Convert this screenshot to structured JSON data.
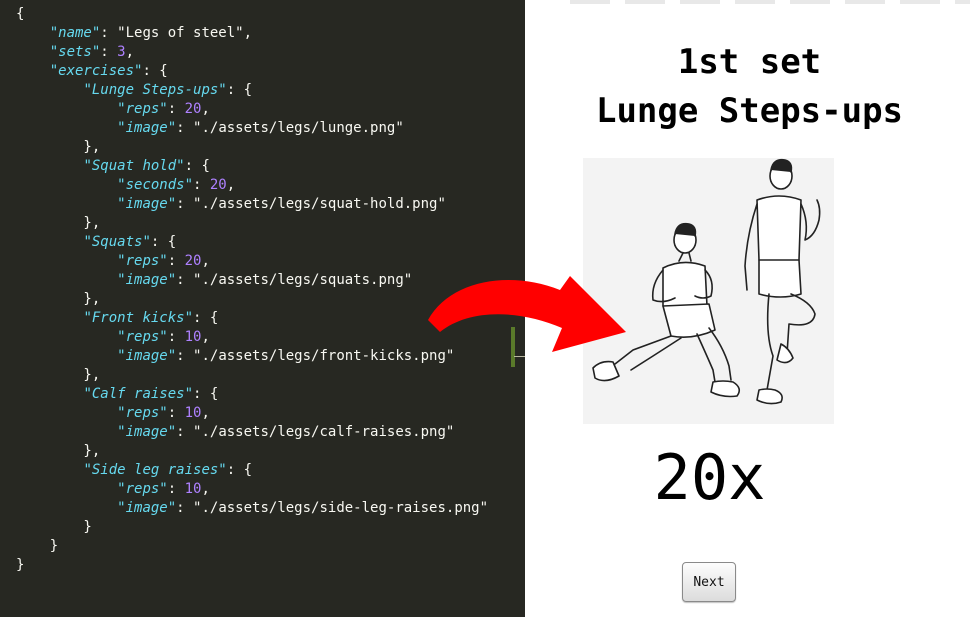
{
  "editor": {
    "lines": [
      [
        {
          "t": "{",
          "c": "p"
        }
      ],
      [
        {
          "t": "    ",
          "c": "p"
        },
        {
          "t": "\"name\"",
          "c": "k"
        },
        {
          "t": ": ",
          "c": "p"
        },
        {
          "t": "\"Legs of steel\"",
          "c": "p"
        },
        {
          "t": ",",
          "c": "p"
        }
      ],
      [
        {
          "t": "    ",
          "c": "p"
        },
        {
          "t": "\"sets\"",
          "c": "k"
        },
        {
          "t": ": ",
          "c": "p"
        },
        {
          "t": "3",
          "c": "n"
        },
        {
          "t": ",",
          "c": "p"
        }
      ],
      [
        {
          "t": "    ",
          "c": "p"
        },
        {
          "t": "\"exercises\"",
          "c": "k"
        },
        {
          "t": ": {",
          "c": "p"
        }
      ],
      [
        {
          "t": "        ",
          "c": "p"
        },
        {
          "t": "\"Lunge Steps-ups\"",
          "c": "k"
        },
        {
          "t": ": {",
          "c": "p"
        }
      ],
      [
        {
          "t": "            ",
          "c": "p"
        },
        {
          "t": "\"reps\"",
          "c": "k"
        },
        {
          "t": ": ",
          "c": "p"
        },
        {
          "t": "20",
          "c": "n"
        },
        {
          "t": ",",
          "c": "p"
        }
      ],
      [
        {
          "t": "            ",
          "c": "p"
        },
        {
          "t": "\"image\"",
          "c": "k"
        },
        {
          "t": ": ",
          "c": "p"
        },
        {
          "t": "\"./assets/legs/lunge.png\"",
          "c": "p"
        }
      ],
      [
        {
          "t": "        },",
          "c": "p"
        }
      ],
      [
        {
          "t": "        ",
          "c": "p"
        },
        {
          "t": "\"Squat hold\"",
          "c": "k"
        },
        {
          "t": ": {",
          "c": "p"
        }
      ],
      [
        {
          "t": "            ",
          "c": "p"
        },
        {
          "t": "\"seconds\"",
          "c": "k"
        },
        {
          "t": ": ",
          "c": "p"
        },
        {
          "t": "20",
          "c": "n"
        },
        {
          "t": ",",
          "c": "p"
        }
      ],
      [
        {
          "t": "            ",
          "c": "p"
        },
        {
          "t": "\"image\"",
          "c": "k"
        },
        {
          "t": ": ",
          "c": "p"
        },
        {
          "t": "\"./assets/legs/squat-hold.png\"",
          "c": "p"
        }
      ],
      [
        {
          "t": "        },",
          "c": "p"
        }
      ],
      [
        {
          "t": "        ",
          "c": "p"
        },
        {
          "t": "\"Squats\"",
          "c": "k"
        },
        {
          "t": ": {",
          "c": "p"
        }
      ],
      [
        {
          "t": "            ",
          "c": "p"
        },
        {
          "t": "\"reps\"",
          "c": "k"
        },
        {
          "t": ": ",
          "c": "p"
        },
        {
          "t": "20",
          "c": "n"
        },
        {
          "t": ",",
          "c": "p"
        }
      ],
      [
        {
          "t": "            ",
          "c": "p"
        },
        {
          "t": "\"image\"",
          "c": "k"
        },
        {
          "t": ": ",
          "c": "p"
        },
        {
          "t": "\"./assets/legs/squats.png\"",
          "c": "p"
        }
      ],
      [
        {
          "t": "        },",
          "c": "p"
        }
      ],
      [
        {
          "t": "        ",
          "c": "p"
        },
        {
          "t": "\"Front kicks\"",
          "c": "k"
        },
        {
          "t": ": {",
          "c": "p"
        }
      ],
      [
        {
          "t": "            ",
          "c": "p"
        },
        {
          "t": "\"reps\"",
          "c": "k"
        },
        {
          "t": ": ",
          "c": "p"
        },
        {
          "t": "10",
          "c": "n"
        },
        {
          "t": ",",
          "c": "p"
        }
      ],
      [
        {
          "t": "            ",
          "c": "p"
        },
        {
          "t": "\"image\"",
          "c": "k"
        },
        {
          "t": ": ",
          "c": "p"
        },
        {
          "t": "\"./assets/legs/front-kicks.png\"",
          "c": "p"
        }
      ],
      [
        {
          "t": "        },",
          "c": "p"
        }
      ],
      [
        {
          "t": "        ",
          "c": "p"
        },
        {
          "t": "\"Calf raises\"",
          "c": "k"
        },
        {
          "t": ": {",
          "c": "p"
        }
      ],
      [
        {
          "t": "            ",
          "c": "p"
        },
        {
          "t": "\"reps\"",
          "c": "k"
        },
        {
          "t": ": ",
          "c": "p"
        },
        {
          "t": "10",
          "c": "n"
        },
        {
          "t": ",",
          "c": "p"
        }
      ],
      [
        {
          "t": "            ",
          "c": "p"
        },
        {
          "t": "\"image\"",
          "c": "k"
        },
        {
          "t": ": ",
          "c": "p"
        },
        {
          "t": "\"./assets/legs/calf-raises.png\"",
          "c": "p"
        }
      ],
      [
        {
          "t": "        },",
          "c": "p"
        }
      ],
      [
        {
          "t": "        ",
          "c": "p"
        },
        {
          "t": "\"Side leg raises\"",
          "c": "k"
        },
        {
          "t": ": {",
          "c": "p"
        }
      ],
      [
        {
          "t": "            ",
          "c": "p"
        },
        {
          "t": "\"reps\"",
          "c": "k"
        },
        {
          "t": ": ",
          "c": "p"
        },
        {
          "t": "10",
          "c": "n"
        },
        {
          "t": ",",
          "c": "p"
        }
      ],
      [
        {
          "t": "            ",
          "c": "p"
        },
        {
          "t": "\"image\"",
          "c": "k"
        },
        {
          "t": ": ",
          "c": "p"
        },
        {
          "t": "\"./assets/legs/side-leg-raises.png\"",
          "c": "p"
        }
      ],
      [
        {
          "t": "        }",
          "c": "p"
        }
      ],
      [
        {
          "t": "    }",
          "c": "p"
        }
      ],
      [
        {
          "t": "}",
          "c": "p"
        }
      ]
    ]
  },
  "preview": {
    "set_title": "1st set",
    "exercise_title": "Lunge Steps-ups",
    "reps_display": "20x",
    "next_label": "Next",
    "image_icon": "lunge-step-up-illustration"
  },
  "colors": {
    "editor_bg": "#272822",
    "key": "#66d9ef",
    "number": "#ae81ff",
    "arrow": "#ff0000"
  }
}
